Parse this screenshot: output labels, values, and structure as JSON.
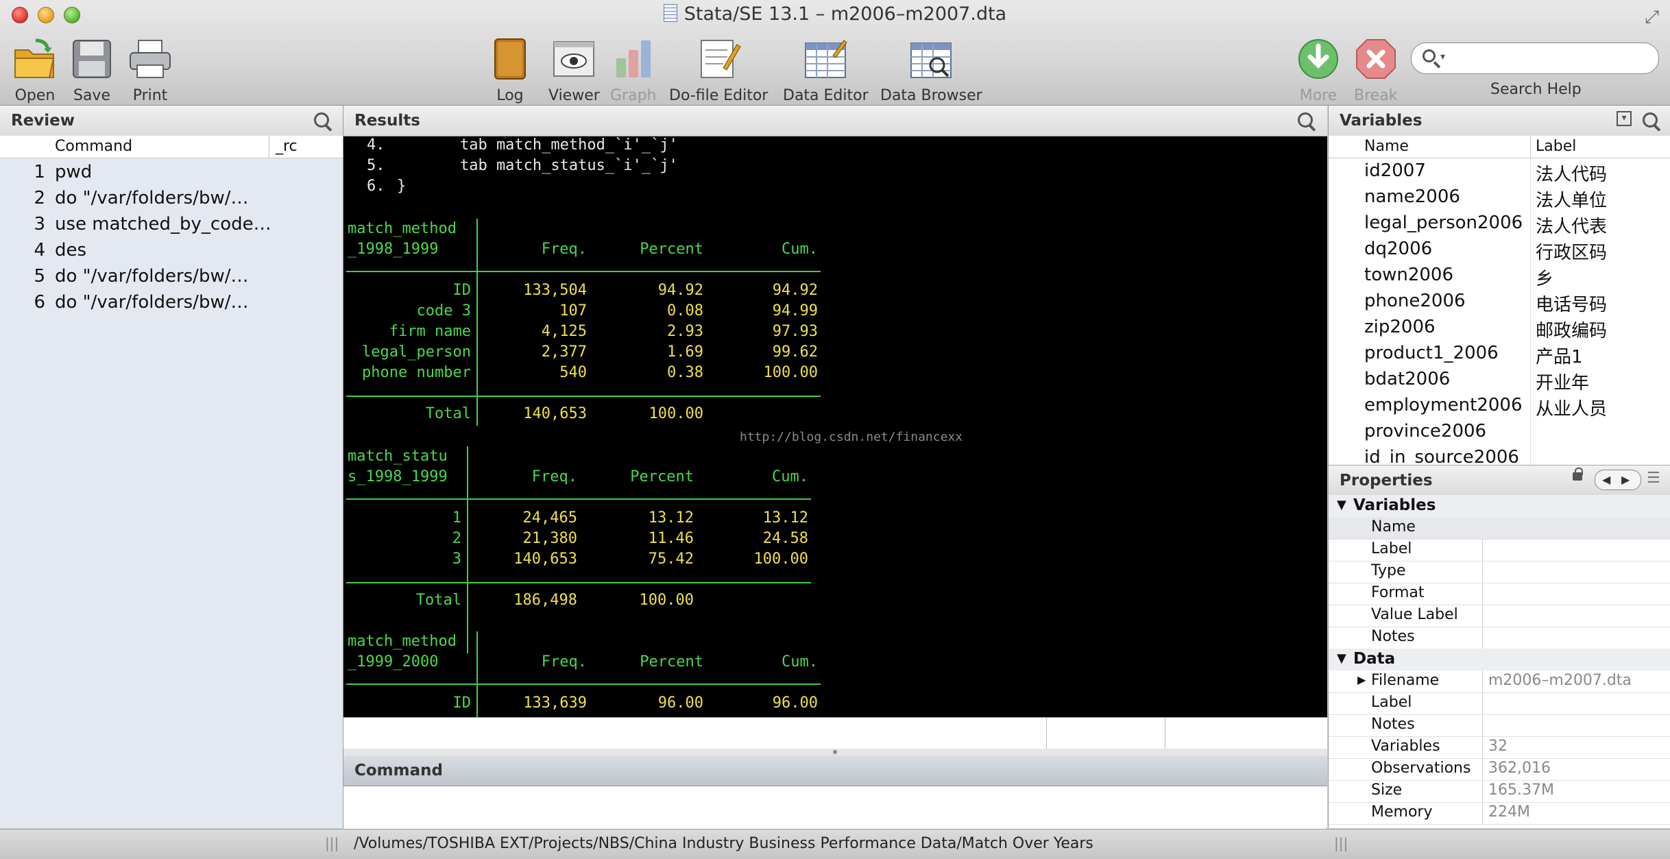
{
  "window": {
    "title": "Stata/SE 13.1 – m2006–m2007.dta"
  },
  "toolbar": {
    "open": "Open",
    "save": "Save",
    "print": "Print",
    "log": "Log",
    "viewer": "Viewer",
    "graph": "Graph",
    "dofile": "Do-file Editor",
    "data_editor": "Data Editor",
    "data_browser": "Data Browser",
    "more": "More",
    "break": "Break",
    "search_help": "Search Help",
    "search_value": ""
  },
  "review": {
    "title": "Review",
    "col_command": "Command",
    "col_rc": "_rc",
    "items": [
      {
        "n": "1",
        "cmd": "pwd"
      },
      {
        "n": "2",
        "cmd": "do \"/var/folders/bw/…"
      },
      {
        "n": "3",
        "cmd": "use matched_by_code…"
      },
      {
        "n": "4",
        "cmd": "des"
      },
      {
        "n": "5",
        "cmd": "do \"/var/folders/bw/…"
      },
      {
        "n": "6",
        "cmd": "do \"/var/folders/bw/…"
      }
    ]
  },
  "results": {
    "title": "Results",
    "code_lines": [
      {
        "num": "4.",
        "text": "        tab match_method_`i'_`j'"
      },
      {
        "num": "5.",
        "text": "        tab match_status_`i'_`j'"
      },
      {
        "num": "6.",
        "text": "}"
      }
    ],
    "watermark": "http://blog.csdn.net/financexx",
    "table1": {
      "var1": "match_method",
      "var2": "_1998_1999",
      "headers": [
        "Freq.",
        "Percent",
        "Cum."
      ],
      "rows": [
        {
          "label": "ID",
          "freq": "133,504",
          "pct": "94.92",
          "cum": "94.92"
        },
        {
          "label": "code 3",
          "freq": "107",
          "pct": "0.08",
          "cum": "94.99"
        },
        {
          "label": "firm name",
          "freq": "4,125",
          "pct": "2.93",
          "cum": "97.93"
        },
        {
          "label": "legal_person",
          "freq": "2,377",
          "pct": "1.69",
          "cum": "99.62"
        },
        {
          "label": "phone number",
          "freq": "540",
          "pct": "0.38",
          "cum": "100.00"
        }
      ],
      "total": {
        "label": "Total",
        "freq": "140,653",
        "pct": "100.00"
      }
    },
    "table2": {
      "var1": "match_statu",
      "var2": "s_1998_1999",
      "headers": [
        "Freq.",
        "Percent",
        "Cum."
      ],
      "rows": [
        {
          "label": "1",
          "freq": "24,465",
          "pct": "13.12",
          "cum": "13.12"
        },
        {
          "label": "2",
          "freq": "21,380",
          "pct": "11.46",
          "cum": "24.58"
        },
        {
          "label": "3",
          "freq": "140,653",
          "pct": "75.42",
          "cum": "100.00"
        }
      ],
      "total": {
        "label": "Total",
        "freq": "186,498",
        "pct": "100.00"
      }
    },
    "table3": {
      "var1": "match_method",
      "var2": "_1999_2000",
      "headers": [
        "Freq.",
        "Percent",
        "Cum."
      ],
      "rows": [
        {
          "label": "ID",
          "freq": "133,639",
          "pct": "96.00",
          "cum": "96.00"
        }
      ]
    }
  },
  "command": {
    "title": "Command",
    "value": ""
  },
  "variables": {
    "title": "Variables",
    "col_name": "Name",
    "col_label": "Label",
    "items": [
      {
        "name": "id2007",
        "label": "法人代码"
      },
      {
        "name": "name2006",
        "label": "法人单位"
      },
      {
        "name": "legal_person2006",
        "label": "法人代表"
      },
      {
        "name": "dq2006",
        "label": "行政区码"
      },
      {
        "name": "town2006",
        "label": "乡"
      },
      {
        "name": "phone2006",
        "label": "电话号码"
      },
      {
        "name": "zip2006",
        "label": "邮政编码"
      },
      {
        "name": "product1_2006",
        "label": "产品1"
      },
      {
        "name": "bdat2006",
        "label": "开业年"
      },
      {
        "name": "employment2006",
        "label": "从业人员"
      },
      {
        "name": "province2006",
        "label": ""
      },
      {
        "name": "id_in_source2006",
        "label": ""
      }
    ]
  },
  "properties": {
    "title": "Properties",
    "sec_variables": "Variables",
    "var_rows": [
      {
        "k": "Name",
        "v": ""
      },
      {
        "k": "Label",
        "v": ""
      },
      {
        "k": "Type",
        "v": ""
      },
      {
        "k": "Format",
        "v": ""
      },
      {
        "k": "Value Label",
        "v": ""
      },
      {
        "k": "Notes",
        "v": ""
      }
    ],
    "sec_data": "Data",
    "data_rows": [
      {
        "k": "Filename",
        "v": "m2006–m2007.dta"
      },
      {
        "k": "Label",
        "v": ""
      },
      {
        "k": "Notes",
        "v": ""
      },
      {
        "k": "Variables",
        "v": "32"
      },
      {
        "k": "Observations",
        "v": "362,016"
      },
      {
        "k": "Size",
        "v": "165.37M"
      },
      {
        "k": "Memory",
        "v": "224M"
      }
    ]
  },
  "status": {
    "path": "/Volumes/TOSHIBA EXT/Projects/NBS/China Industry Business Performance Data/Match Over Years"
  }
}
